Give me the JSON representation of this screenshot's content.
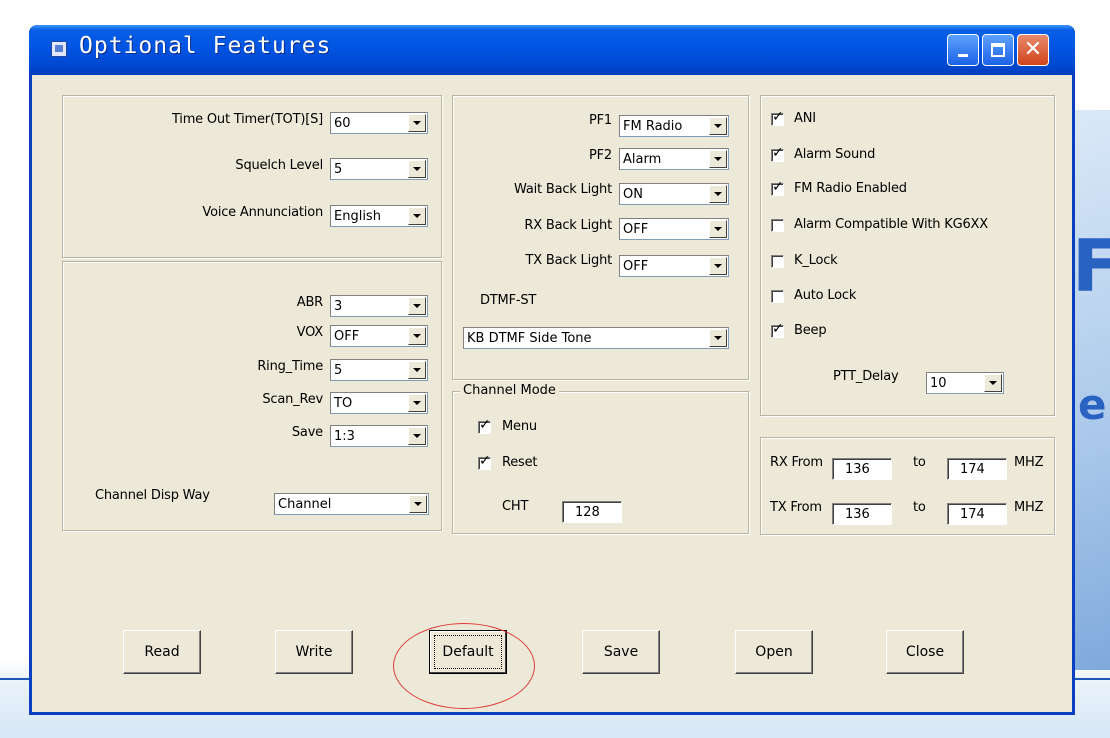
{
  "window": {
    "title": "Optional Features",
    "controls": [
      "minimize",
      "maximize",
      "close"
    ]
  },
  "background": {
    "letter_f": "F",
    "letter_e": "e"
  },
  "left_top": {
    "tot_label": "Time Out Timer(TOT)[S]",
    "tot_value": "60",
    "squelch_label": "Squelch Level",
    "squelch_value": "5",
    "voice_label": "Voice Annunciation",
    "voice_value": "English"
  },
  "left_bottom": {
    "abr_label": "ABR",
    "abr_value": "3",
    "vox_label": "VOX",
    "vox_value": "OFF",
    "ring_label": "Ring_Time",
    "ring_value": "5",
    "scan_label": "Scan_Rev",
    "scan_value": "TO",
    "save_label": "Save",
    "save_value": "1:3",
    "disp_label": "Channel Disp Way",
    "disp_value": "Channel"
  },
  "middle": {
    "pf1_label": "PF1",
    "pf1_value": "FM Radio",
    "pf2_label": "PF2",
    "pf2_value": "Alarm",
    "wait_label": "Wait Back Light",
    "wait_value": "ON",
    "rx_label": "RX Back Light",
    "rx_value": "OFF",
    "tx_label": "TX Back Light",
    "tx_value": "OFF",
    "dtmf_label": "DTMF-ST",
    "dtmf_value": "KB DTMF Side Tone"
  },
  "channel_mode": {
    "title": "Channel Mode",
    "menu_label": "Menu",
    "menu_checked": true,
    "reset_label": "Reset",
    "reset_checked": true,
    "cht_label": "CHT",
    "cht_value": "128"
  },
  "right_checks": {
    "ani": "ANI",
    "alarm_sound": "Alarm Sound",
    "fm_enabled": "FM Radio Enabled",
    "alarm_compat": "Alarm Compatible With KG6XX",
    "k_lock": "K_Lock",
    "auto_lock": "Auto Lock",
    "beep": "Beep",
    "ptt_label": "PTT_Delay",
    "ptt_value": "10"
  },
  "freq": {
    "rx_label": "RX From",
    "rx_from": "136",
    "rx_to_label": "to",
    "rx_to": "174",
    "rx_unit": "MHZ",
    "tx_label": "TX From",
    "tx_from": "136",
    "tx_to_label": "to",
    "tx_to": "174",
    "tx_unit": "MHZ"
  },
  "buttons": {
    "read": "Read",
    "write": "Write",
    "default": "Default",
    "save": "Save",
    "open": "Open",
    "close": "Close"
  },
  "colors": {
    "titlebar": "#0054e3",
    "window_face": "#ece9d8",
    "highlight_ring": "#e03c3c"
  }
}
